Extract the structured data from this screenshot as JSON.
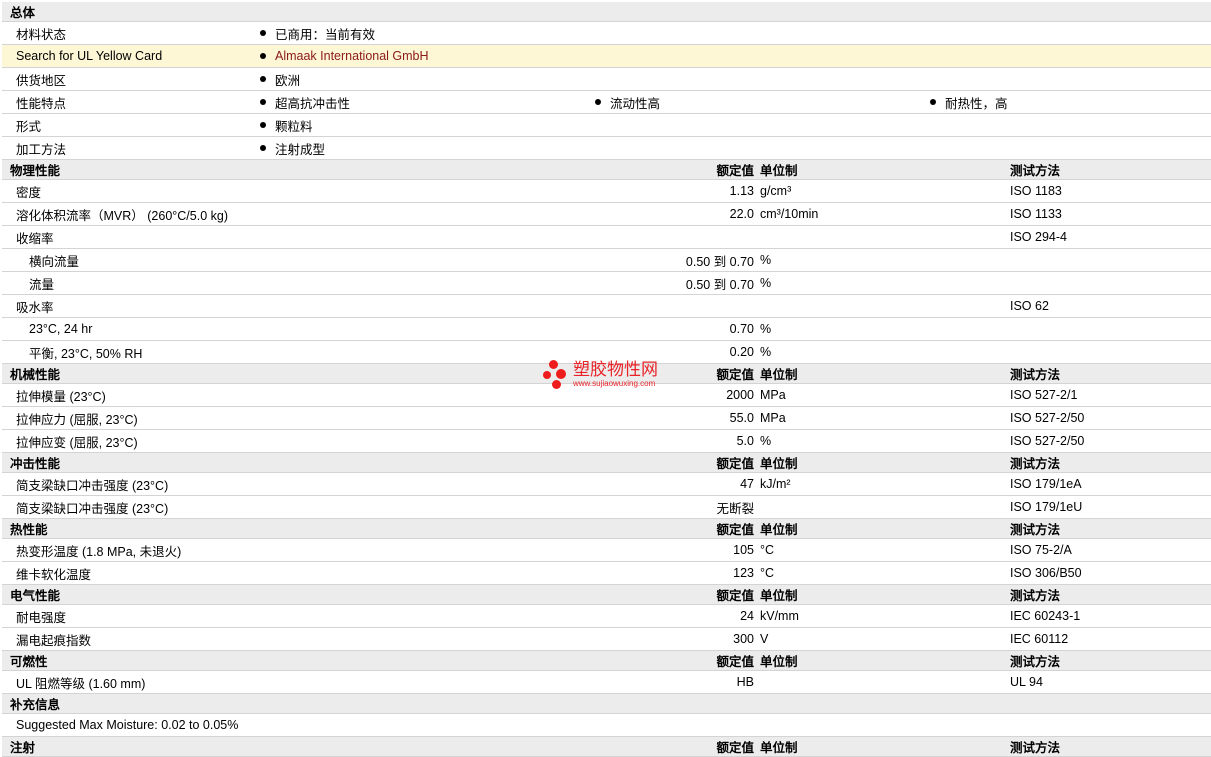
{
  "headers": {
    "value": "额定值",
    "unit": "单位制",
    "test": "测试方法"
  },
  "general": {
    "title": "总体",
    "rows": [
      {
        "label": "材料状态",
        "items": [
          "已商用：当前有效"
        ]
      },
      {
        "label": "Search for UL Yellow Card",
        "items": [
          "Almaak International GmbH"
        ],
        "highlight": true,
        "link": true
      },
      {
        "label": "供货地区",
        "items": [
          "欧洲"
        ]
      },
      {
        "label": "性能特点",
        "items": [
          "超高抗冲击性",
          "流动性高",
          "耐热性，高"
        ]
      },
      {
        "label": "形式",
        "items": [
          "颗粒料"
        ]
      },
      {
        "label": "加工方法",
        "items": [
          "注射成型"
        ]
      }
    ]
  },
  "sections": [
    {
      "title": "物理性能",
      "rows": [
        {
          "name": "密度",
          "value": "1.13",
          "unit": "g/cm³",
          "test": "ISO 1183"
        },
        {
          "name": "溶化体积流率（MVR） (260°C/5.0 kg)",
          "value": "22.0",
          "unit": "cm³/10min",
          "test": "ISO 1133"
        },
        {
          "name": "收缩率",
          "value": "",
          "unit": "",
          "test": "ISO 294-4"
        },
        {
          "name": "横向流量",
          "value": "0.50 到  0.70",
          "unit": "%",
          "test": "",
          "sub": true
        },
        {
          "name": "流量",
          "value": "0.50 到  0.70",
          "unit": "%",
          "test": "",
          "sub": true
        },
        {
          "name": "吸水率",
          "value": "",
          "unit": "",
          "test": "ISO 62"
        },
        {
          "name": "23°C, 24 hr",
          "value": "0.70",
          "unit": "%",
          "test": "",
          "sub": true
        },
        {
          "name": "平衡, 23°C, 50% RH",
          "value": "0.20",
          "unit": "%",
          "test": "",
          "sub": true
        }
      ]
    },
    {
      "title": "机械性能",
      "rows": [
        {
          "name": "拉伸模量  (23°C)",
          "value": "2000",
          "unit": "MPa",
          "test": "ISO 527-2/1"
        },
        {
          "name": "拉伸应力  (屈服, 23°C)",
          "value": "55.0",
          "unit": "MPa",
          "test": "ISO 527-2/50"
        },
        {
          "name": "拉伸应变  (屈服, 23°C)",
          "value": "5.0",
          "unit": "%",
          "test": "ISO 527-2/50"
        }
      ]
    },
    {
      "title": "冲击性能",
      "rows": [
        {
          "name": "简支梁缺口冲击强度  (23°C)",
          "value": "47",
          "unit": "kJ/m²",
          "test": "ISO 179/1eA"
        },
        {
          "name": "简支梁缺口冲击强度  (23°C)",
          "value": "无断裂",
          "unit": "",
          "test": "ISO 179/1eU"
        }
      ]
    },
    {
      "title": "热性能",
      "rows": [
        {
          "name": "热变形温度  (1.8 MPa, 未退火)",
          "value": "105",
          "unit": "°C",
          "test": "ISO 75-2/A"
        },
        {
          "name": "维卡软化温度",
          "value": "123",
          "unit": "°C",
          "test": "ISO 306/B50"
        }
      ]
    },
    {
      "title": "电气性能",
      "rows": [
        {
          "name": "耐电强度",
          "value": "24",
          "unit": "kV/mm",
          "test": "IEC 60243-1"
        },
        {
          "name": "漏电起痕指数",
          "value": "300",
          "unit": "V",
          "test": "IEC 60112"
        }
      ]
    },
    {
      "title": "可燃性",
      "rows": [
        {
          "name": "UL 阻燃等级  (1.60 mm)",
          "value": "HB",
          "unit": "",
          "test": "UL 94"
        }
      ]
    },
    {
      "title": "补充信息",
      "noHeaders": true,
      "rows": [
        {
          "name": "Suggested Max Moisture: 0.02 to 0.05%",
          "value": "",
          "unit": "",
          "test": ""
        }
      ]
    },
    {
      "title": "注射",
      "rows": []
    }
  ],
  "watermark": {
    "text": "塑胶物性网",
    "url": "www.sujiaowuxing.com",
    "color": "#e8242a"
  }
}
